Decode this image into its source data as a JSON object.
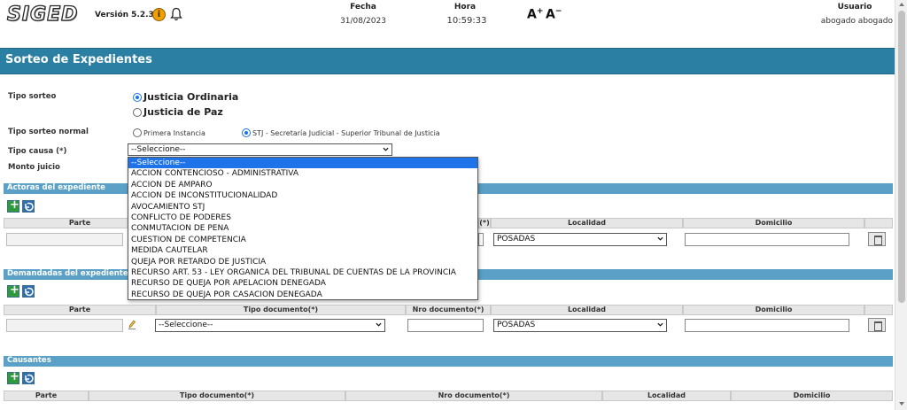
{
  "header": {
    "logo": "SIGED",
    "version": "Versión 5.2.3",
    "fecha_label": "Fecha",
    "fecha_value": "31/08/2023",
    "hora_label": "Hora",
    "hora_value": "10:59:33",
    "font_inc": "A",
    "font_dec": "A",
    "usuario_label": "Usuario",
    "usuario_value": "abogado abogado"
  },
  "page_title": "Sorteo de Expedientes",
  "form": {
    "tipo_sorteo_label": "Tipo sorteo",
    "tipo_sorteo_options": [
      "Justicia Ordinaria",
      "Justicia de Paz"
    ],
    "tipo_sorteo_normal_label": "Tipo sorteo normal",
    "tipo_sorteo_normal_options": [
      "Primera Instancia",
      "STJ - Secretaría Judicial - Superior Tribunal de Justicia"
    ],
    "tipo_causa_label": "Tipo causa (*)",
    "tipo_causa_value": "--Seleccione--",
    "monto_juicio_label": "Monto juicio"
  },
  "tipo_causa_dropdown": [
    "--Seleccione--",
    "ACCION CONTENCIOSO - ADMINISTRATIVA",
    "ACCION DE AMPARO",
    "ACCION DE INCONSTITUCIONALIDAD",
    "AVOCAMIENTO STJ",
    "CONFLICTO DE PODERES",
    "CONMUTACION DE PENA",
    "CUESTION DE COMPETENCIA",
    "MEDIDA CAUTELAR",
    "QUEJA POR RETARDO DE JUSTICIA",
    "RECURSO ART. 53 - LEY ORGANICA DEL TRIBUNAL DE CUENTAS DE LA PROVINCIA",
    "RECURSO DE QUEJA POR APELACION DENEGADA",
    "RECURSO DE QUEJA POR CASACION DENEGADA"
  ],
  "actoras": {
    "title": "Actoras del expediente",
    "columns": [
      "Parte",
      "(*)",
      "Localidad",
      "Domicilio"
    ],
    "localidad_value": "POSADAS"
  },
  "demandadas": {
    "title": "Demandadas del expediente",
    "columns": [
      "Parte",
      "Tipo documento(*)",
      "Nro documento(*)",
      "Localidad",
      "Domicilio"
    ],
    "tipo_doc_value": "--Seleccione--",
    "localidad_value": "POSADAS"
  },
  "causantes": {
    "title": "Causantes",
    "columns": [
      "Parte",
      "Tipo documento(*)",
      "Nro documento(*)",
      "Localidad",
      "Domicilio"
    ]
  },
  "colors": {
    "title_bar": "#2a7fa3",
    "section_bar": "#5aa0c7",
    "dropdown_selected": "#1e73e8"
  }
}
